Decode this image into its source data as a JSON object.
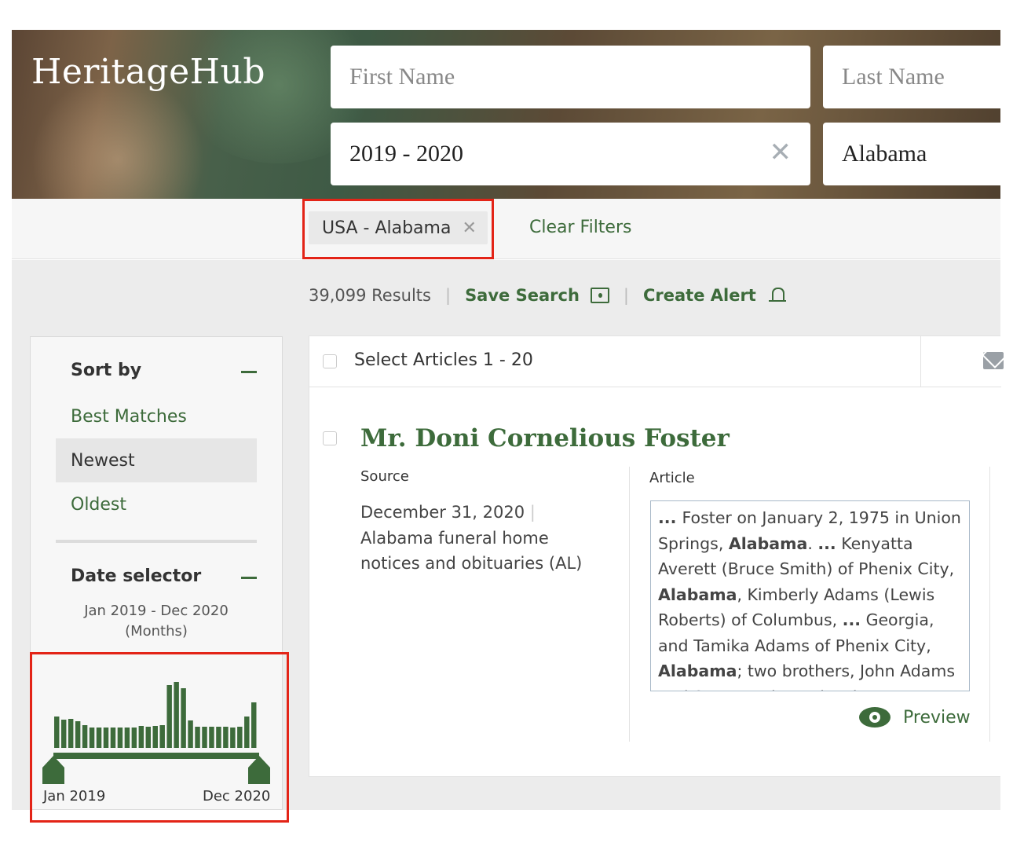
{
  "brand": {
    "logo": "HeritageHub",
    "accent": "#3d6b3b",
    "highlight": "#e32417"
  },
  "search": {
    "first_name_placeholder": "First Name",
    "last_name_placeholder": "Last Name",
    "date_value": "2019 - 2020",
    "state_value": "Alabama"
  },
  "filters": {
    "chip_label": "USA - Alabama",
    "clear_label": "Clear Filters"
  },
  "results": {
    "count": "39,099 Results",
    "save_search": "Save Search",
    "create_alert": "Create Alert",
    "select_label": "Select Articles 1 - 20"
  },
  "sidebar": {
    "sort_heading": "Sort by",
    "sort_options": [
      "Best Matches",
      "Newest",
      "Oldest"
    ],
    "selected_sort": "Newest",
    "date_heading": "Date selector",
    "date_range": "Jan 2019 - Dec 2020",
    "date_unit": "(Months)",
    "hist_start": "Jan 2019",
    "hist_end": "Dec 2020",
    "hist_values": [
      40,
      36,
      37,
      34,
      29,
      26,
      26,
      26,
      26,
      26,
      26,
      26,
      28,
      27,
      28,
      29,
      80,
      84,
      76,
      35,
      27,
      27,
      27,
      27,
      27,
      26,
      27,
      40,
      58
    ]
  },
  "article": {
    "title": "Mr. Doni Cornelious Foster",
    "source_heading": "Source",
    "article_heading": "Article",
    "date": "December 31, 2020",
    "source_name": "Alabama funeral home notices and obituaries (AL)",
    "snippet": [
      {
        "t": "... ",
        "b": true
      },
      {
        "t": "Foster on January 2, 1975 in Union Springs, ",
        "b": false
      },
      {
        "t": "Alabama",
        "b": true
      },
      {
        "t": ". ",
        "b": false
      },
      {
        "t": "...",
        "b": true
      },
      {
        "t": " Kenyatta Averett (Bruce Smith) of Phenix City, ",
        "b": false
      },
      {
        "t": "Alabama",
        "b": true
      },
      {
        "t": ", Kimberly Adams (Lewis Roberts) of Columbus, ",
        "b": false
      },
      {
        "t": "...",
        "b": true
      },
      {
        "t": " Georgia, and Tamika Adams of Phenix City, ",
        "b": false
      },
      {
        "t": "Alabama",
        "b": true
      },
      {
        "t": "; two brothers, John Adams and Steven Adams; brother",
        "b": false
      }
    ],
    "preview_label": "Preview"
  }
}
